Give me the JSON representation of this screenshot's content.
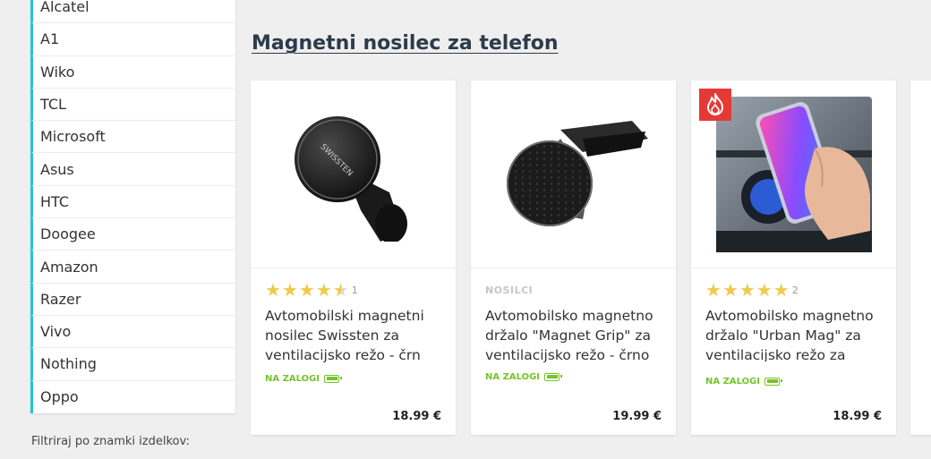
{
  "sidebar": {
    "brands": [
      "Alcatel",
      "A1",
      "Wiko",
      "TCL",
      "Microsoft",
      "Asus",
      "HTC",
      "Doogee",
      "Amazon",
      "Razer",
      "Vivo",
      "Nothing",
      "Oppo"
    ],
    "filter_label": "Filtriraj po znamki izdelkov:",
    "accent_color": "#26c6d0"
  },
  "section": {
    "title": "Magnetni nosilec za telefon"
  },
  "products": [
    {
      "rating": 4.5,
      "review_count": "1",
      "name": "Avtomobilski magnetni nosilec Swissten za ventilacijsko režo - črn",
      "stock": "NA ZALOGI",
      "price": "18.99 €",
      "image_icon": "round-magnetic-vent-mount-image"
    },
    {
      "category": "NOSILCI",
      "name": "Avtomobilsko magnetno držalo \"Magnet Grip\" za ventilacijsko režo - črno",
      "stock": "NA ZALOGI",
      "price": "19.99 €",
      "image_icon": "magnet-grip-vent-mount-image"
    },
    {
      "rating": 5,
      "review_count": "2",
      "name": "Avtomobilsko magnetno držalo \"Urban Mag\" za ventilacijsko režo za",
      "stock": "NA ZALOGI",
      "price": "18.99 €",
      "badge_icon": "flame-icon",
      "image_icon": "phone-in-car-mount-photo"
    }
  ],
  "colors": {
    "stock": "#76c32a",
    "stars": "#f2c94c",
    "hot_badge": "#e53935"
  }
}
